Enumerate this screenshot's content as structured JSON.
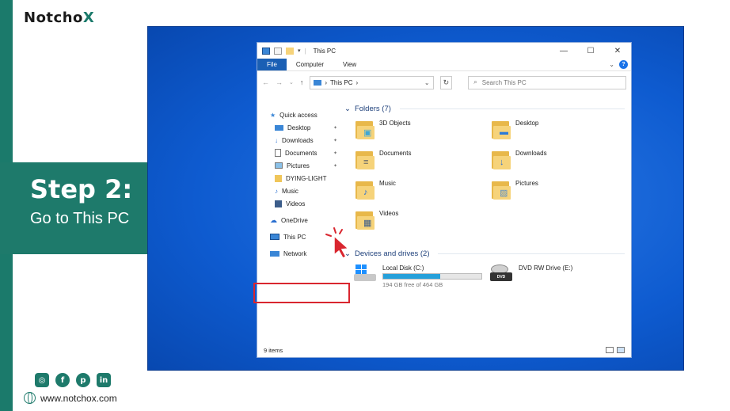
{
  "brand": {
    "logo_main": "Notcho",
    "logo_x": "X",
    "website": "www.notchox.com"
  },
  "step": {
    "title": "Step 2:",
    "subtitle": "Go to This PC"
  },
  "socials": [
    "instagram-icon",
    "facebook-icon",
    "pinterest-icon",
    "linkedin-icon"
  ],
  "explorer": {
    "title": "This PC",
    "window_controls": {
      "minimize": "—",
      "maximize": "☐",
      "close": "✕"
    },
    "ribbon_tabs": [
      "File",
      "Computer",
      "View"
    ],
    "address": {
      "path": "This PC",
      "separator": "›"
    },
    "search_placeholder": "Search This PC",
    "nav": [
      {
        "label": "Quick access",
        "icon": "star-icon",
        "pinned": false
      },
      {
        "label": "Desktop",
        "icon": "desktop-icon",
        "pinned": true
      },
      {
        "label": "Downloads",
        "icon": "downloads-icon",
        "pinned": true
      },
      {
        "label": "Documents",
        "icon": "documents-icon",
        "pinned": true
      },
      {
        "label": "Pictures",
        "icon": "pictures-icon",
        "pinned": true
      },
      {
        "label": "DYING-LIGHT",
        "icon": "folder-icon",
        "pinned": false
      },
      {
        "label": "Music",
        "icon": "music-icon",
        "pinned": false
      },
      {
        "label": "Videos",
        "icon": "videos-icon",
        "pinned": false
      },
      {
        "label": "OneDrive",
        "icon": "cloud-icon",
        "pinned": false
      },
      {
        "label": "This PC",
        "icon": "computer-icon",
        "pinned": false
      },
      {
        "label": "Network",
        "icon": "network-icon",
        "pinned": false
      }
    ],
    "folders_header": "Folders (7)",
    "folders": [
      {
        "label": "3D Objects",
        "glyph": "▣"
      },
      {
        "label": "Desktop",
        "glyph": "▬"
      },
      {
        "label": "Documents",
        "glyph": "≡"
      },
      {
        "label": "Downloads",
        "glyph": "↓"
      },
      {
        "label": "Music",
        "glyph": "♪"
      },
      {
        "label": "Pictures",
        "glyph": "▨"
      },
      {
        "label": "Videos",
        "glyph": "▦"
      }
    ],
    "devices_header": "Devices and drives (2)",
    "drives": [
      {
        "label": "Local Disk (C:)",
        "free": "194 GB free of 464 GB",
        "used_fraction": 0.58
      },
      {
        "label": "DVD RW Drive (E:)",
        "badge": "DVD"
      }
    ],
    "status": "9 items"
  },
  "colors": {
    "brand_green": "#1e7a6b",
    "highlight_red": "#d9262f",
    "desktop_blue": "#0e5bd0"
  }
}
